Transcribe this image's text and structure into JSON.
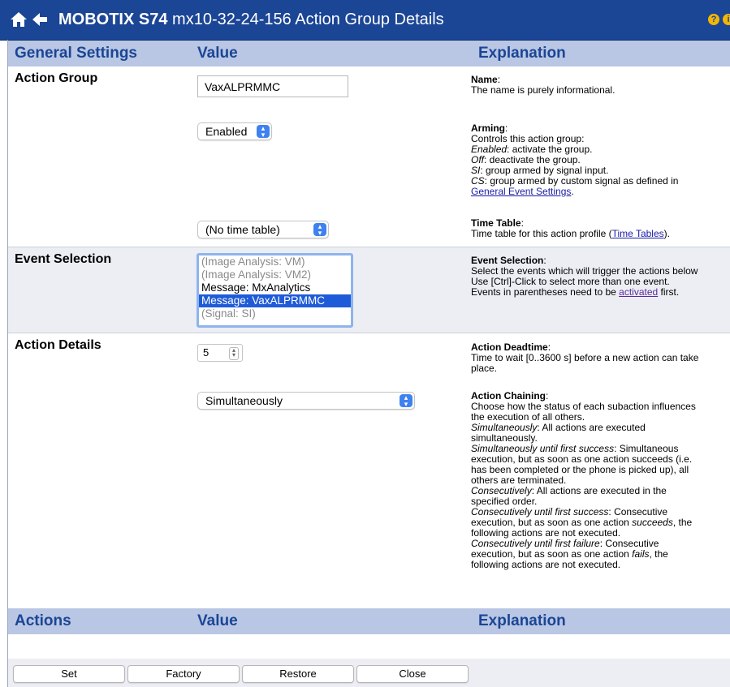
{
  "titlebar": {
    "brand": "MOBOTIX S74",
    "subtitle": "mx10-32-24-156 Action Group Details",
    "help_glyph": "?",
    "info_glyph": "i",
    "accent_color": "#1b4595"
  },
  "header1": {
    "col1": "General Settings",
    "col2": "Value",
    "col3": "Explanation"
  },
  "action_group": {
    "label": "Action Group",
    "name_value": "VaxALPRMMC",
    "arming_value": "Enabled",
    "timetable_value": "(No time table)",
    "name_expl": {
      "title": "Name",
      "text": "The name is purely informational."
    },
    "arming_expl": {
      "title": "Arming",
      "line1": "Controls this action group:",
      "enabled_term": "Enabled",
      "enabled_text": ": activate the group.",
      "off_term": "Off",
      "off_text": ": deactivate the group.",
      "si_term": "SI",
      "si_text": ": group armed by signal input.",
      "cs_term": "CS",
      "cs_text": ": group armed by custom signal as defined in",
      "link": "General Event Settings"
    },
    "time_expl": {
      "title": "Time Table",
      "text_before": "Time table for this action profile (",
      "link": "Time Tables",
      "text_after": ")."
    }
  },
  "event_selection": {
    "label": "Event Selection",
    "options": [
      {
        "text": "(Image Analysis: VM)",
        "state": "disabled"
      },
      {
        "text": "(Image Analysis: VM2)",
        "state": "disabled"
      },
      {
        "text": "Message: MxAnalytics",
        "state": "normal"
      },
      {
        "text": "Message: VaxALPRMMC",
        "state": "selected"
      },
      {
        "text": "(Signal: SI)",
        "state": "disabled"
      }
    ],
    "expl": {
      "title": "Event Selection",
      "line1": "Select the events which will trigger the actions below",
      "line2": "Use [Ctrl]-Click to select more than one event.",
      "line3_before": "Events in parentheses need to be ",
      "line3_link": "activated",
      "line3_after": " first."
    }
  },
  "action_details": {
    "label": "Action Details",
    "deadtime_value": "5",
    "chaining_value": "Simultaneously",
    "deadtime_expl": {
      "title": "Action Deadtime",
      "line1": "Time to wait [0..3600 s] before a new action can take",
      "line2": "place."
    },
    "chaining_expl": {
      "title": "Action Chaining",
      "l1": "Choose how the status of each subaction influences",
      "l2": "the execution of all others.",
      "t3": "Simultaneously",
      "l3": ": All actions are executed",
      "l4": "simultaneously.",
      "t5": "Simultaneously until first success",
      "l5": ": Simultaneous",
      "l6": "execution, but as soon as one action succeeds (i.e.",
      "l7": "has been completed or the phone is picked up), all",
      "l8": "others are terminated.",
      "t9": "Consecutively",
      "l9": ": All actions are executed in the",
      "l10": "specified order.",
      "t11": "Consecutively until first success",
      "l11": ": Consecutive",
      "l12a": "execution, but as soon as one action ",
      "l12i": "succeeds",
      "l12b": ", the",
      "l13": "following actions are not executed.",
      "t14": "Consecutively until first failure",
      "l14": ": Consecutive",
      "l15a": "execution, but as soon as one action ",
      "l15i": "fails",
      "l15b": ", the",
      "l16": "following actions are not executed."
    }
  },
  "header2": {
    "col1": "Actions",
    "col2": "Value",
    "col3": "Explanation"
  },
  "buttons": {
    "set": "Set",
    "factory": "Factory",
    "restore": "Restore",
    "close": "Close"
  }
}
